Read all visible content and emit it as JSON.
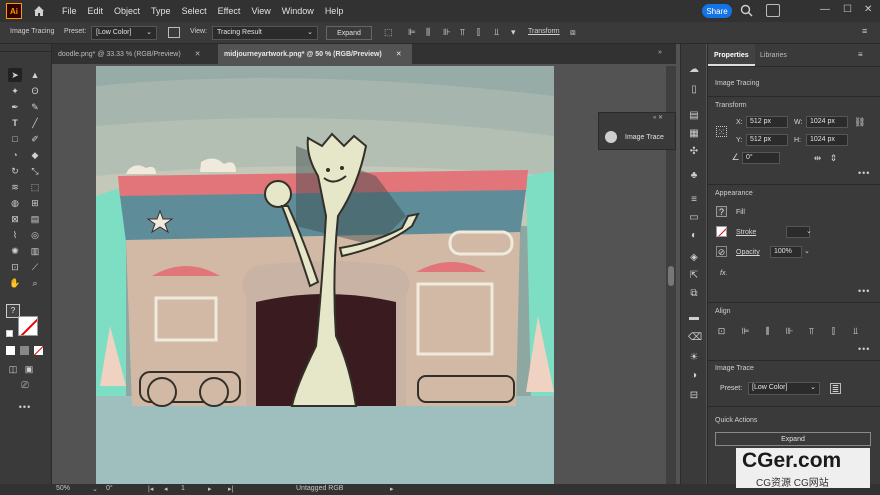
{
  "menubar": {
    "logo": "Ai",
    "menus": [
      "File",
      "Edit",
      "Object",
      "Type",
      "Select",
      "Effect",
      "View",
      "Window",
      "Help"
    ],
    "share": "Share"
  },
  "control_bar": {
    "mode_label": "Image Tracing",
    "preset_label": "Preset:",
    "preset_value": "[Low Color]",
    "view_label": "View:",
    "view_value": "Tracing Result",
    "expand": "Expand",
    "transform": "Transform"
  },
  "tabs": [
    {
      "label": "doodle.png* @ 33.33 % (RGB/Preview)",
      "active": false
    },
    {
      "label": "midjourneyartwork.png* @ 50 % (RGB/Preview)",
      "active": true
    }
  ],
  "float_panel": {
    "label": "Image Trace"
  },
  "properties": {
    "tabs": [
      "Properties",
      "Libraries"
    ],
    "context": "Image Tracing",
    "transform": {
      "title": "Transform",
      "x_label": "X:",
      "x": "512 px",
      "y_label": "Y:",
      "y": "512 px",
      "w_label": "W:",
      "w": "1024 px",
      "h_label": "H:",
      "h": "1024 px",
      "angle": "0°"
    },
    "appearance": {
      "title": "Appearance",
      "fill": "Fill",
      "stroke": "Stroke",
      "opacity_label": "Opacity",
      "opacity": "100%",
      "fx": "fx."
    },
    "align": {
      "title": "Align"
    },
    "image_trace": {
      "title": "Image Trace",
      "preset_label": "Preset:",
      "preset_value": "[Low Color]"
    },
    "quick_actions": {
      "title": "Quick Actions",
      "expand": "Expand"
    }
  },
  "status": {
    "zoom": "50%",
    "angle": "0°",
    "artboard": "1",
    "doc_profile": "Untagged RGB"
  },
  "watermark": {
    "main": "CGer.com",
    "sub": "CG资源 CG网站"
  },
  "colors": {
    "accent": "#1473e6",
    "panel": "#3a3a3a",
    "bg": "#535353"
  }
}
